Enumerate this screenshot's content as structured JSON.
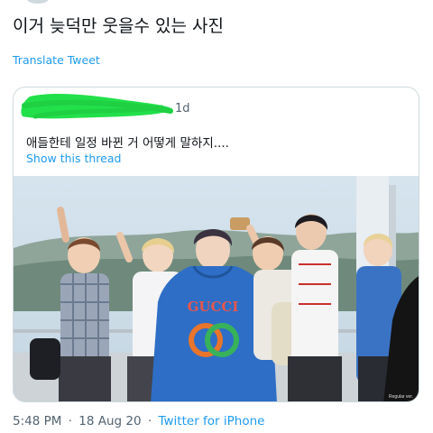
{
  "tweet": {
    "text": "이거 늦덕만 웃을수 있는 사진",
    "translate_label": "Translate Tweet",
    "time": "5:48 PM",
    "date": "18 Aug 20",
    "separator": "·",
    "source": "Twitter for iPhone"
  },
  "quoted_tweet": {
    "age": "1d",
    "text": "애들한테 일정 바뀐 거 어떻게 말하지....",
    "show_thread_label": "Show this thread",
    "author_redaction_color": "#22e04a",
    "photo_watermark": "Regular ver."
  },
  "colors": {
    "link": "#1d9bf0",
    "muted": "#536471",
    "text": "#0f1419",
    "border": "#cfd9de"
  }
}
